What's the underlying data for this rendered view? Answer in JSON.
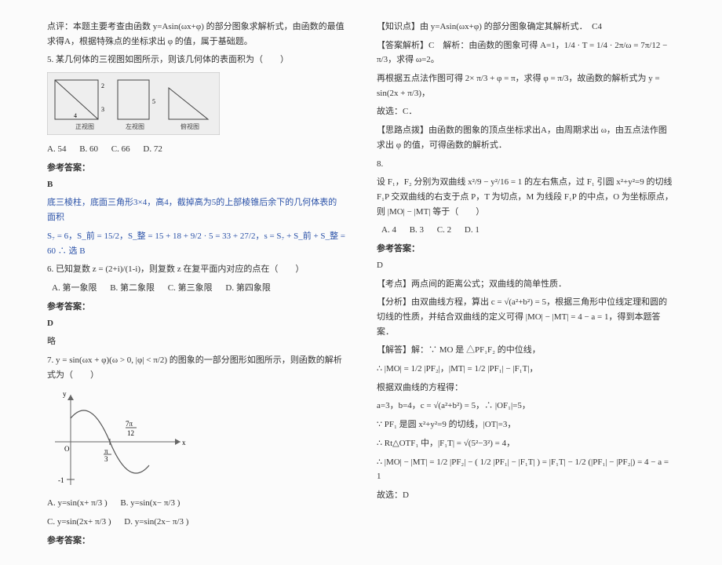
{
  "left": {
    "comment": "点评：本题主要考查由函数 y=Asin(ωx+φ) 的部分图象求解析式，由函数的最值求得A，根据特殊点的坐标求出 φ 的值，属于基础题。",
    "q5": "5. 某几何体的三视图如图所示，则该几何体的表面积为（　　）",
    "q5opts": [
      "A. 54",
      "B. 60",
      "C. 66",
      "D. 72"
    ],
    "answer_label": "参考答案：",
    "ans5big": "B",
    "ans5line1": "底三棱柱，底面三角形3×4，高4，截掉高为5的上部棱锥后余下的几何体表的面积",
    "ans5line2": "S₇ = 6，S_前 = 15/2，S_整 = 15 + 18 + 9/2 · 5 = 33 + 27/2，s = S₇ + S_前 + S_整 = 60 ∴ 选 B",
    "q6": "6. 已知复数 z = (2+i)/(1-i)，则复数 z 在复平面内对应的点在（　　）",
    "q6opts": [
      "A. 第一象限",
      "B. 第二象限",
      "C. 第三象限",
      "D. 第四象限"
    ],
    "ans6": "D",
    "ans6note": "略",
    "q7": "7. y = sin(ωx + φ)(ω > 0, |φ| < π/2) 的图象的一部分图形如图所示，则函数的解析式为（　　）",
    "q7optA": "A. y=sin(x+ π/3 )",
    "q7optB": "B. y=sin(x− π/3 )",
    "q7optC": "C. y=sin(2x+ π/3 )",
    "q7optD": "D. y=sin(2x− π/3 )"
  },
  "right": {
    "knowledge": "【知识点】由 y=Asin(ωx+φ) 的部分图象确定其解析式．　C4",
    "ans_header": "【答案解析】C　解析：由函数的图象可得 A=1，1/4 · T = 1/4 · 2π/ω = 7π/12 − π/3，求得 ω=2。",
    "ans_line2": "再根据五点法作图可得 2× π/3 + φ = π，求得 φ = π/3，故函数的解析式为 y = sin(2x + π/3)，",
    "ans_line3": "故选：C．",
    "think": "【思路点拨】由函数的图象的顶点坐标求出A，由周期求出 ω，由五点法作图求出 φ 的值，可得函数的解析式．",
    "q8num": "8.",
    "q8": "设 F₁，F₂ 分别为双曲线 x²/9 − y²/16 = 1 的左右焦点，过 F₁ 引圆 x²+y²=9 的切线 F₁P 交双曲线的右支于点 P，T 为切点，M 为线段 F₁P 的中点，O 为坐标原点，则 |MO| − |MT| 等于（　　）",
    "q8opts": [
      "A. 4",
      "B. 3",
      "C. 2",
      "D. 1"
    ],
    "answer_label": "参考答案：",
    "ans8": "D",
    "exam_point": "【考点】两点间的距离公式；双曲线的简单性质．",
    "analysis": "【分析】由双曲线方程，算出 c = √(a²+b²) = 5，根据三角形中位线定理和圆的切线的性质，并结合双曲线的定义可得 |MO| − |MT| = 4 − a = 1，得到本题答案．",
    "solve_label": "【解答】解：∵ MO 是 △PF₁F₂ 的中位线，",
    "solve_l1": "∴ |MO| = 1/2 |PF₂|，|MT| = 1/2 |PF₁| − |F₁T|，",
    "solve_l2": "根据双曲线的方程得：",
    "solve_l3": "a=3，b=4，c = √(a²+b²) = 5，∴ |OF₁|=5，",
    "solve_l4": "∵ PF₁ 是圆 x²+y²=9 的切线，|OT|=3，",
    "solve_l5": "∴ Rt△OTF₁ 中，|F₁T| = √(5²−3²) = 4，",
    "solve_l6": "∴ |MO| − |MT| = 1/2 |PF₂| − ( 1/2 |PF₁| − |F₁T| ) = |F₁T| − 1/2 (|PF₁| − |PF₂|) = 4 − a = 1",
    "solve_l7": "故选：D"
  },
  "chart_data": [
    {
      "type": "diagram",
      "name": "three-views",
      "views": [
        "正视图",
        "左视图",
        "俯视图"
      ],
      "dimensions": {
        "width": 4,
        "depths": [
          5,
          2,
          3
        ]
      }
    },
    {
      "type": "line",
      "name": "sine-partial",
      "title": "",
      "xlabel": "x",
      "ylabel": "y",
      "ylim": [
        -1,
        1
      ],
      "annotations": [
        "π/3",
        "7π/12"
      ],
      "series": [
        {
          "name": "y",
          "shape": "one-period-sine",
          "zero_crossings": [
            "π/3"
          ],
          "peak_x": "7π/12"
        }
      ]
    }
  ]
}
